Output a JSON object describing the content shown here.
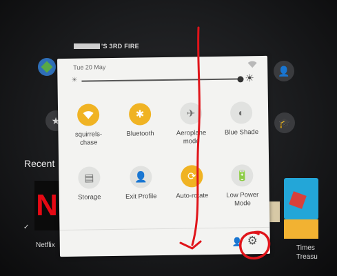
{
  "device": {
    "name_suffix": "'S 3RD FIRE"
  },
  "background": {
    "recent_label": "Recent",
    "netflix_label": "Netflix",
    "times_label_line1": "Times",
    "times_label_line2": "Treasu"
  },
  "status": {
    "date": "Tue 20 May"
  },
  "tiles": [
    {
      "label_line1": "squirrels-",
      "label_line2": "chase",
      "icon": "wifi-icon",
      "state": "on"
    },
    {
      "label_line1": "Bluetooth",
      "label_line2": "",
      "icon": "bluetooth-icon",
      "state": "on"
    },
    {
      "label_line1": "Aeroplane",
      "label_line2": "mode",
      "icon": "airplane-icon",
      "state": "off"
    },
    {
      "label_line1": "Blue Shade",
      "label_line2": "",
      "icon": "blue-shade-icon",
      "state": "off"
    },
    {
      "label_line1": "Storage",
      "label_line2": "",
      "icon": "storage-icon",
      "state": "off"
    },
    {
      "label_line1": "Exit Profile",
      "label_line2": "",
      "icon": "exit-profile-icon",
      "state": "off"
    },
    {
      "label_line1": "Auto-rotate",
      "label_line2": "",
      "icon": "auto-rotate-icon",
      "state": "on"
    },
    {
      "label_line1": "Low Power",
      "label_line2": "Mode",
      "icon": "low-power-icon",
      "state": "off"
    }
  ],
  "colors": {
    "accent": "#f0b323",
    "panel": "#f3f3f1",
    "annotation": "#e0141a"
  }
}
